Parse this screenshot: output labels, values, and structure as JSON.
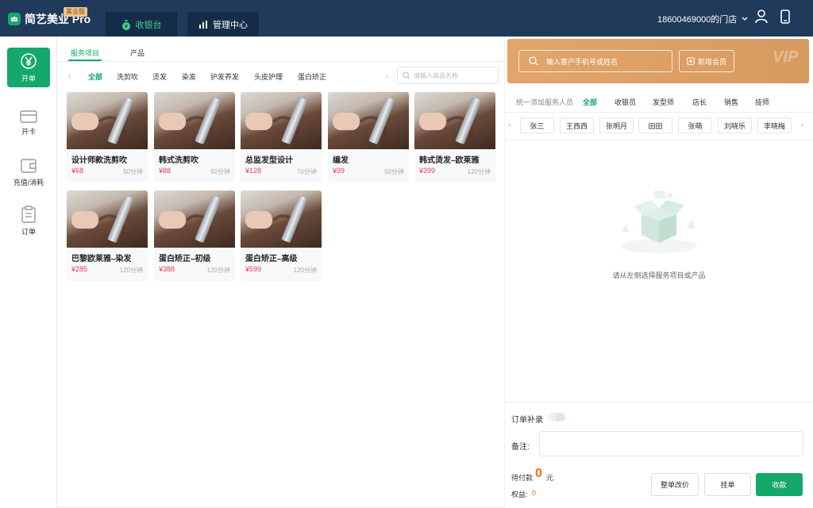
{
  "colors": {
    "topbar": "#1f3a5a",
    "accent": "#14a86a",
    "price": "#e8405b",
    "vip_card": "#e2a56b",
    "amount": "#f2701e"
  },
  "header": {
    "logo_text": "简艺美业 Pro",
    "edition": "美业版",
    "nav_cashier": "收银台",
    "nav_admin": "管理中心",
    "store_name": "18600469000的门店",
    "icons": [
      "chevron-down-icon",
      "user-icon",
      "phone-icon"
    ]
  },
  "sidebar": {
    "items": [
      {
        "label": "开单",
        "icon": "yen-icon",
        "active": true
      },
      {
        "label": "开卡",
        "icon": "card-icon"
      },
      {
        "label": "充值/消耗",
        "icon": "wallet-icon"
      },
      {
        "label": "订单",
        "icon": "clipboard-icon"
      }
    ]
  },
  "catalog": {
    "tabs": [
      "服务项目",
      "产品"
    ],
    "active_tab": "服务项目",
    "categories": [
      "全部",
      "洗剪吹",
      "烫发",
      "染发",
      "护发养发",
      "头皮护理",
      "蛋白矫正"
    ],
    "active_category": "全部",
    "search_placeholder": "请输入商品名称",
    "items": [
      {
        "name": "设计师款洗剪吹",
        "price": "¥68",
        "duration": "50分钟"
      },
      {
        "name": "韩式洗剪吹",
        "price": "¥88",
        "duration": "50分钟"
      },
      {
        "name": "总监发型设计",
        "price": "¥128",
        "duration": "70分钟"
      },
      {
        "name": "编发",
        "price": "¥99",
        "duration": "50分钟"
      },
      {
        "name": "韩式烫发–欧莱雅",
        "price": "¥399",
        "duration": "120分钟"
      },
      {
        "name": "巴黎欧莱雅–染发",
        "price": "¥285",
        "duration": "120分钟"
      },
      {
        "name": "蛋白矫正–初级",
        "price": "¥388",
        "duration": "120分钟"
      },
      {
        "name": "蛋白矫正–高级",
        "price": "¥599",
        "duration": "120分钟"
      }
    ]
  },
  "member": {
    "search_placeholder": "输入客户手机号或姓名",
    "add_label": "新增会员",
    "vip_mark": "VIP"
  },
  "staff": {
    "label": "统一添加服务人员",
    "roles": [
      "全部",
      "收银员",
      "发型师",
      "店长",
      "销售",
      "技师"
    ],
    "active_role": "全部",
    "names": [
      "张三",
      "王西西",
      "张明月",
      "田田",
      "张萌",
      "刘晓乐",
      "李晓梅"
    ]
  },
  "order": {
    "empty_text": "请从左侧选择服务项目或产品",
    "supplement_label": "订单补录",
    "remark_label": "备注:",
    "payable_label": "待付款",
    "payable_amount": "0",
    "payable_unit": "元",
    "equity_label": "权益:",
    "equity_value": "0",
    "btn_change_price": "整单改价",
    "btn_hold": "挂单",
    "btn_pay": "收款"
  }
}
